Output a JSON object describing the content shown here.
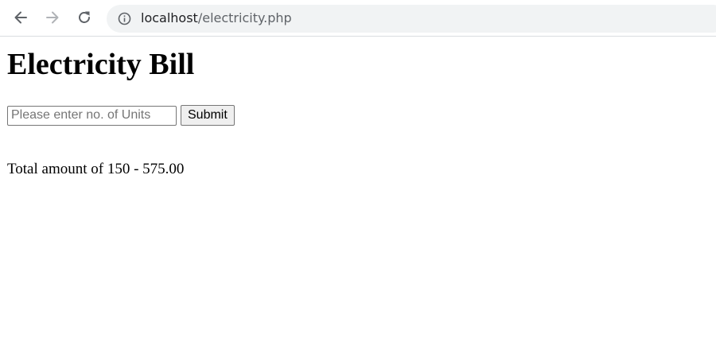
{
  "browser": {
    "url_host": "localhost",
    "url_path": "/electricity.php",
    "back_icon": "arrow-left-icon",
    "forward_icon": "arrow-right-icon",
    "reload_icon": "reload-icon",
    "info_icon": "info-circle-icon"
  },
  "page": {
    "title": "Electricity Bill",
    "units_input": {
      "value": "",
      "placeholder": "Please enter no. of Units"
    },
    "submit_label": "Submit",
    "result_text": "Total amount of 150 - 575.00"
  },
  "colors": {
    "toolbar_icon": "#5f6368",
    "toolbar_icon_disabled": "#b0b3b7",
    "omnibox_bg": "#f1f3f4"
  }
}
